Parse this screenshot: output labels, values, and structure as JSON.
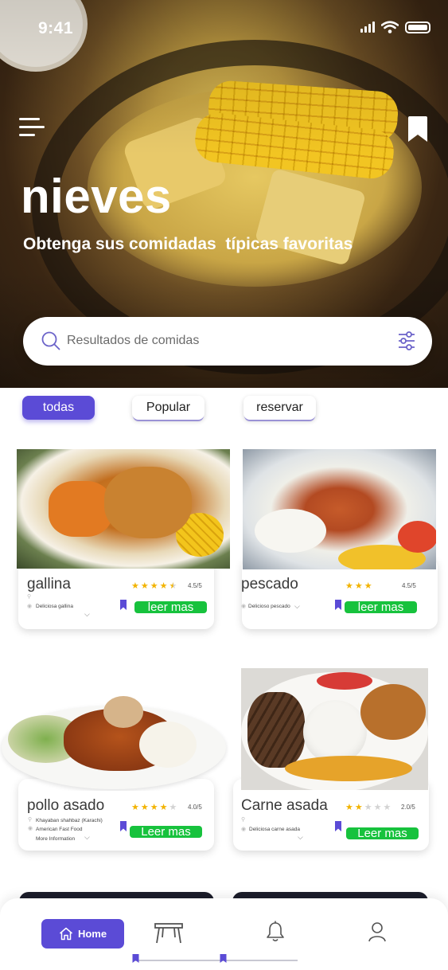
{
  "status_bar": {
    "time": "9:41"
  },
  "header": {
    "brand": "nieves",
    "tagline": "Obtenga sus comidadas  típicas favoritas",
    "menu_icon": "hamburger-menu-icon",
    "bookmark_icon": "bookmark-icon"
  },
  "search": {
    "placeholder": "Resultados de comidas",
    "search_icon": "search-icon",
    "filter_icon": "sliders-filter-icon"
  },
  "filters": {
    "selected": "todas",
    "chips": [
      "todas",
      "Popular",
      "reservar"
    ]
  },
  "colors": {
    "accent": "#5b4bd6",
    "read_more": "#17c23d",
    "star": "#f2b300"
  },
  "cards": [
    {
      "name": "gallina",
      "stars": 4.5,
      "rating": "4.5/5",
      "lines": [
        "",
        "Deliciosa gallina"
      ],
      "button": "leer mas"
    },
    {
      "name": "pescado",
      "stars": 3,
      "rating": "4.5/5",
      "lines": [
        "Delicioso pescado"
      ],
      "button": "leer mas"
    },
    {
      "name": "pollo asado",
      "stars": 4,
      "rating": "4.0/5",
      "lines": [
        "Khayaban shahbaz (Karachi)",
        "American Fast Food",
        "More Information"
      ],
      "button": "Leer mas"
    },
    {
      "name": "Carne asada",
      "stars": 2,
      "rating": "2.0/5",
      "lines": [
        "",
        "Deliciosa carne asada"
      ],
      "button": "Leer mas"
    }
  ],
  "bottom_nav": {
    "home_label": "Home",
    "items": [
      "home-icon",
      "table-icon",
      "bell-icon",
      "user-icon"
    ]
  }
}
